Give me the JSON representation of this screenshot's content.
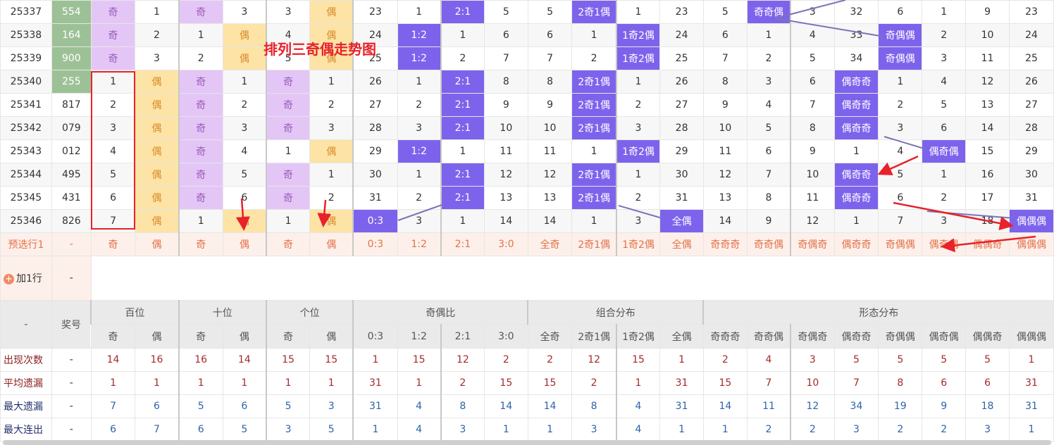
{
  "watermark": "排列三奇偶走势图",
  "rows": [
    {
      "issue": "25337",
      "num": "554",
      "cells": [
        "奇",
        "1",
        "奇",
        "3",
        "3",
        "偶",
        "23",
        "1",
        "2:1",
        "5",
        "5",
        "2奇1偶",
        "1",
        "23",
        "5",
        "奇奇偶",
        "3",
        "32",
        "6",
        "1",
        "9",
        "23"
      ]
    },
    {
      "issue": "25338",
      "num": "164",
      "cells": [
        "奇",
        "2",
        "1",
        "偶",
        "4",
        "偶",
        "24",
        "1:2",
        "1",
        "6",
        "6",
        "1",
        "1奇2偶",
        "24",
        "6",
        "1",
        "4",
        "33",
        "奇偶偶",
        "2",
        "10",
        "24"
      ]
    },
    {
      "issue": "25339",
      "num": "900",
      "cells": [
        "奇",
        "3",
        "2",
        "偶",
        "5",
        "偶",
        "25",
        "1:2",
        "2",
        "7",
        "7",
        "2",
        "1奇2偶",
        "25",
        "7",
        "2",
        "5",
        "34",
        "奇偶偶",
        "3",
        "11",
        "25"
      ]
    },
    {
      "issue": "25340",
      "num": "255",
      "cells": [
        "1",
        "偶",
        "奇",
        "1",
        "奇",
        "1",
        "26",
        "1",
        "2:1",
        "8",
        "8",
        "2奇1偶",
        "1",
        "26",
        "8",
        "3",
        "6",
        "偶奇奇",
        "1",
        "4",
        "12",
        "26"
      ]
    },
    {
      "issue": "25341",
      "num": "817",
      "cells": [
        "2",
        "偶",
        "奇",
        "2",
        "奇",
        "2",
        "27",
        "2",
        "2:1",
        "9",
        "9",
        "2奇1偶",
        "2",
        "27",
        "9",
        "4",
        "7",
        "偶奇奇",
        "2",
        "5",
        "13",
        "27"
      ]
    },
    {
      "issue": "25342",
      "num": "079",
      "cells": [
        "3",
        "偶",
        "奇",
        "3",
        "奇",
        "3",
        "28",
        "3",
        "2:1",
        "10",
        "10",
        "2奇1偶",
        "3",
        "28",
        "10",
        "5",
        "8",
        "偶奇奇",
        "3",
        "6",
        "14",
        "28"
      ]
    },
    {
      "issue": "25343",
      "num": "012",
      "cells": [
        "4",
        "偶",
        "奇",
        "4",
        "1",
        "偶",
        "29",
        "1:2",
        "1",
        "11",
        "11",
        "1",
        "1奇2偶",
        "29",
        "11",
        "6",
        "9",
        "1",
        "4",
        "偶奇偶",
        "15",
        "29"
      ]
    },
    {
      "issue": "25344",
      "num": "495",
      "cells": [
        "5",
        "偶",
        "奇",
        "5",
        "奇",
        "1",
        "30",
        "1",
        "2:1",
        "12",
        "12",
        "2奇1偶",
        "1",
        "30",
        "12",
        "7",
        "10",
        "偶奇奇",
        "5",
        "1",
        "16",
        "30"
      ]
    },
    {
      "issue": "25345",
      "num": "431",
      "cells": [
        "6",
        "偶",
        "奇",
        "6",
        "奇",
        "2",
        "31",
        "2",
        "2:1",
        "13",
        "13",
        "2奇1偶",
        "2",
        "31",
        "13",
        "8",
        "11",
        "偶奇奇",
        "6",
        "2",
        "17",
        "31"
      ]
    },
    {
      "issue": "25346",
      "num": "826",
      "cells": [
        "7",
        "偶",
        "1",
        "偶",
        "1",
        "偶",
        "0:3",
        "3",
        "1",
        "14",
        "14",
        "1",
        "3",
        "全偶",
        "14",
        "9",
        "12",
        "1",
        "7",
        "3",
        "18",
        "偶偶偶"
      ]
    }
  ],
  "preselect": {
    "label": "预选行1",
    "dash": "-",
    "cells": [
      "奇",
      "偶",
      "奇",
      "偶",
      "奇",
      "偶",
      "0:3",
      "1:2",
      "2:1",
      "3:0",
      "全奇",
      "2奇1偶",
      "1奇2偶",
      "全偶",
      "奇奇奇",
      "奇奇偶",
      "奇偶奇",
      "偶奇奇",
      "奇偶偶",
      "偶奇偶",
      "偶偶奇",
      "偶偶偶"
    ]
  },
  "add_row": {
    "icon": "+",
    "label": "加1行",
    "dash": "-"
  },
  "header": {
    "dash": "-",
    "prize": "奖号",
    "groups": [
      {
        "label": "百位"
      },
      {
        "label": "十位"
      },
      {
        "label": "个位"
      },
      {
        "label": "奇偶比"
      },
      {
        "label": "组合分布"
      },
      {
        "label": "形态分布"
      }
    ],
    "subs": [
      "奇",
      "偶",
      "奇",
      "偶",
      "奇",
      "偶",
      "0:3",
      "1:2",
      "2:1",
      "3:0",
      "全奇",
      "2奇1偶",
      "1奇2偶",
      "全偶",
      "奇奇奇",
      "奇奇偶",
      "奇偶奇",
      "偶奇奇",
      "奇偶偶",
      "偶奇偶",
      "偶偶奇",
      "偶偶偶"
    ]
  },
  "stats": [
    {
      "label": "出现次数",
      "dash": "-",
      "values": [
        "14",
        "16",
        "16",
        "14",
        "15",
        "15",
        "1",
        "15",
        "12",
        "2",
        "2",
        "12",
        "15",
        "1",
        "2",
        "4",
        "3",
        "5",
        "5",
        "5",
        "5",
        "1"
      ]
    },
    {
      "label": "平均遗漏",
      "dash": "-",
      "values": [
        "1",
        "1",
        "1",
        "1",
        "1",
        "1",
        "31",
        "1",
        "2",
        "15",
        "15",
        "2",
        "1",
        "31",
        "15",
        "7",
        "10",
        "7",
        "8",
        "6",
        "6",
        "31"
      ]
    },
    {
      "label": "最大遗漏",
      "dash": "-",
      "values": [
        "7",
        "6",
        "5",
        "6",
        "5",
        "3",
        "31",
        "4",
        "8",
        "14",
        "14",
        "8",
        "4",
        "31",
        "14",
        "11",
        "12",
        "34",
        "19",
        "9",
        "18",
        "31"
      ]
    },
    {
      "label": "最大连出",
      "dash": "-",
      "values": [
        "6",
        "7",
        "6",
        "5",
        "3",
        "5",
        "1",
        "4",
        "3",
        "1",
        "1",
        "3",
        "4",
        "1",
        "1",
        "2",
        "2",
        "3",
        "2",
        "2",
        "3",
        "1"
      ]
    }
  ],
  "colors": {
    "green": "#9dc196",
    "purple": "#e3c6f6",
    "yellow": "#fde4a6",
    "blue": "#7d63ec",
    "red": "#e8212a",
    "connector": "#7b74b8"
  }
}
